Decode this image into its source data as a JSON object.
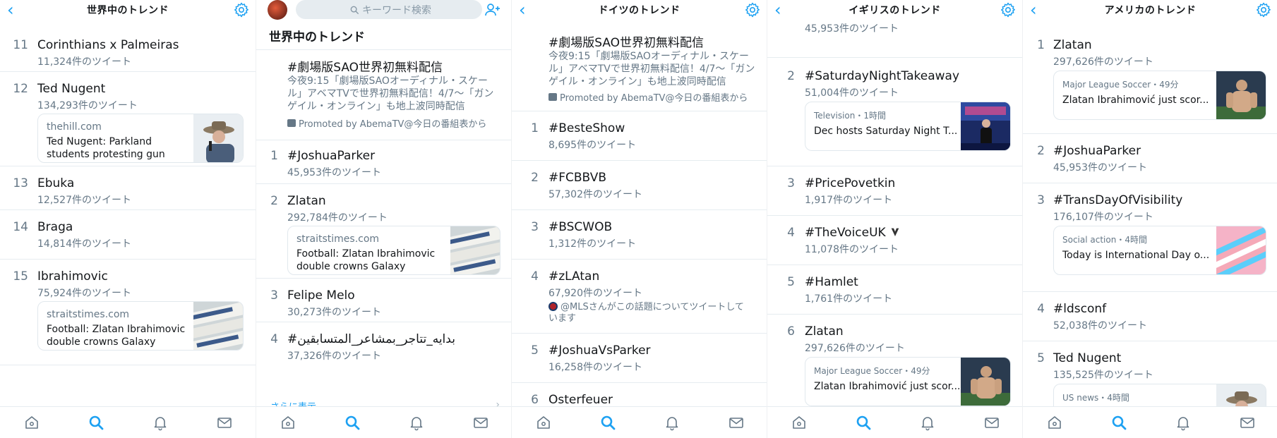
{
  "panels": [
    {
      "title": "世界中のトレンド",
      "trends": [
        {
          "rank": "11",
          "name": "Corinthians x Palmeiras",
          "count": "11,324件のツイート"
        },
        {
          "rank": "12",
          "name": "Ted Nugent",
          "count": "134,293件のツイート",
          "card": {
            "source": "thehill.com",
            "headline": "Ted Nugent: Parkland students protesting gun viol...",
            "thumb": "ted-nugent-photo"
          }
        },
        {
          "rank": "13",
          "name": "Ebuka",
          "count": "12,527件のツイート"
        },
        {
          "rank": "14",
          "name": "Braga",
          "count": "14,814件のツイート"
        },
        {
          "rank": "15",
          "name": "Ibrahimovic",
          "count": "75,924件のツイート",
          "card": {
            "source": "straitstimes.com",
            "headline": "Football: Zlatan Ibrahimovic double crowns Galaxy fightb...",
            "thumb": "newspaper-photo"
          }
        }
      ]
    },
    {
      "search_placeholder": "キーワード検索",
      "section_title": "世界中のトレンド",
      "promoted": {
        "name": "#劇場版SAO世界初無料配信",
        "description": "今夜9:15「劇場版SAOオーディナル・スケール」アベマTVで世界初無料配信！4/7〜「ガンゲイル・オンライン」も地上波同時配信",
        "ad_line": "Promoted by AbemaTV@今日の番組表から"
      },
      "trends": [
        {
          "rank": "1",
          "name": "#JoshuaParker",
          "count": "45,953件のツイート"
        },
        {
          "rank": "2",
          "name": "Zlatan",
          "count": "292,784件のツイート",
          "card": {
            "source": "straitstimes.com",
            "headline": "Football: Zlatan Ibrahimovic double crowns Galaxy fightba...",
            "thumb": "newspaper-photo"
          }
        },
        {
          "rank": "3",
          "name": "Felipe Melo",
          "count": "30,273件のツイート"
        },
        {
          "rank": "4",
          "name": "#بدايه_تتاجر_بمشاعر_المتسابقين",
          "count": "37,326件のツイート"
        }
      ],
      "more": "さらに表示"
    },
    {
      "title": "ドイツのトレンド",
      "promoted": {
        "name": "#劇場版SAO世界初無料配信",
        "description": "今夜9:15「劇場版SAOオーディナル・スケール」アベマTVで世界初無料配信！4/7〜「ガンゲイル・オンライン」も地上波同時配信",
        "ad_line": "Promoted by AbemaTV@今日の番組表から"
      },
      "trends": [
        {
          "rank": "1",
          "name": "#BesteShow",
          "count": "8,695件のツイート"
        },
        {
          "rank": "2",
          "name": "#FCBBVB",
          "count": "57,302件のツイート"
        },
        {
          "rank": "3",
          "name": "#BSCWOB",
          "count": "1,312件のツイート"
        },
        {
          "rank": "4",
          "name": "#zLAtan",
          "count": "67,920件のツイート",
          "note": "@MLSさんがこの話題についてツイートしています"
        },
        {
          "rank": "5",
          "name": "#JoshuaVsParker",
          "count": "16,258件のツイート"
        },
        {
          "rank": "6",
          "name": "Osterfeuer",
          "count": ""
        }
      ]
    },
    {
      "title": "イギリスのトレンド",
      "top_count": "45,953件のツイート",
      "trends": [
        {
          "rank": "2",
          "name": "#SaturdayNightTakeaway",
          "count": "51,004件のツイート",
          "card": {
            "source": "Television・1時間",
            "headline": "Dec hosts Saturday Night T...",
            "thumb": "tv-stage-photo"
          }
        },
        {
          "rank": "3",
          "name": "#PricePovetkin",
          "count": "1,917件のツイート"
        },
        {
          "rank": "4",
          "name": "#TheVoiceUK",
          "count": "11,078件のツイート"
        },
        {
          "rank": "5",
          "name": "#Hamlet",
          "count": "1,761件のツイート"
        },
        {
          "rank": "6",
          "name": "Zlatan",
          "count": "297,626件のツイート",
          "card": {
            "source": "Major League Soccer・49分",
            "headline": "Zlatan Ibrahimović just scor...",
            "thumb": "soccer-player-photo"
          }
        }
      ]
    },
    {
      "title": "アメリカのトレンド",
      "trends": [
        {
          "rank": "1",
          "name": "Zlatan",
          "count": "297,626件のツイート",
          "card": {
            "source": "Major League Soccer・49分",
            "headline": "Zlatan Ibrahimović just scor...",
            "thumb": "soccer-player-photo"
          }
        },
        {
          "rank": "2",
          "name": "#JoshuaParker",
          "count": "45,953件のツイート"
        },
        {
          "rank": "3",
          "name": "#TransDayOfVisibility",
          "count": "176,107件のツイート",
          "card": {
            "source": "Social action・4時間",
            "headline": "Today is International Day o...",
            "thumb": "trans-flag-photo"
          }
        },
        {
          "rank": "4",
          "name": "#ldsconf",
          "count": "52,038件のツイート"
        },
        {
          "rank": "5",
          "name": "Ted Nugent",
          "count": "135,525件のツイート",
          "card": {
            "source": "US news・4時間",
            "headline": "",
            "thumb": "ted-nugent-photo"
          }
        }
      ]
    }
  ],
  "icons": {
    "back": "chevron-left-icon",
    "settings": "gear-icon",
    "tabs": [
      "home-icon",
      "search-icon",
      "bell-icon",
      "mail-icon"
    ]
  },
  "colors": {
    "accent": "#1da1f2",
    "secondary_text": "#657786",
    "divider": "#e6ecf0"
  }
}
